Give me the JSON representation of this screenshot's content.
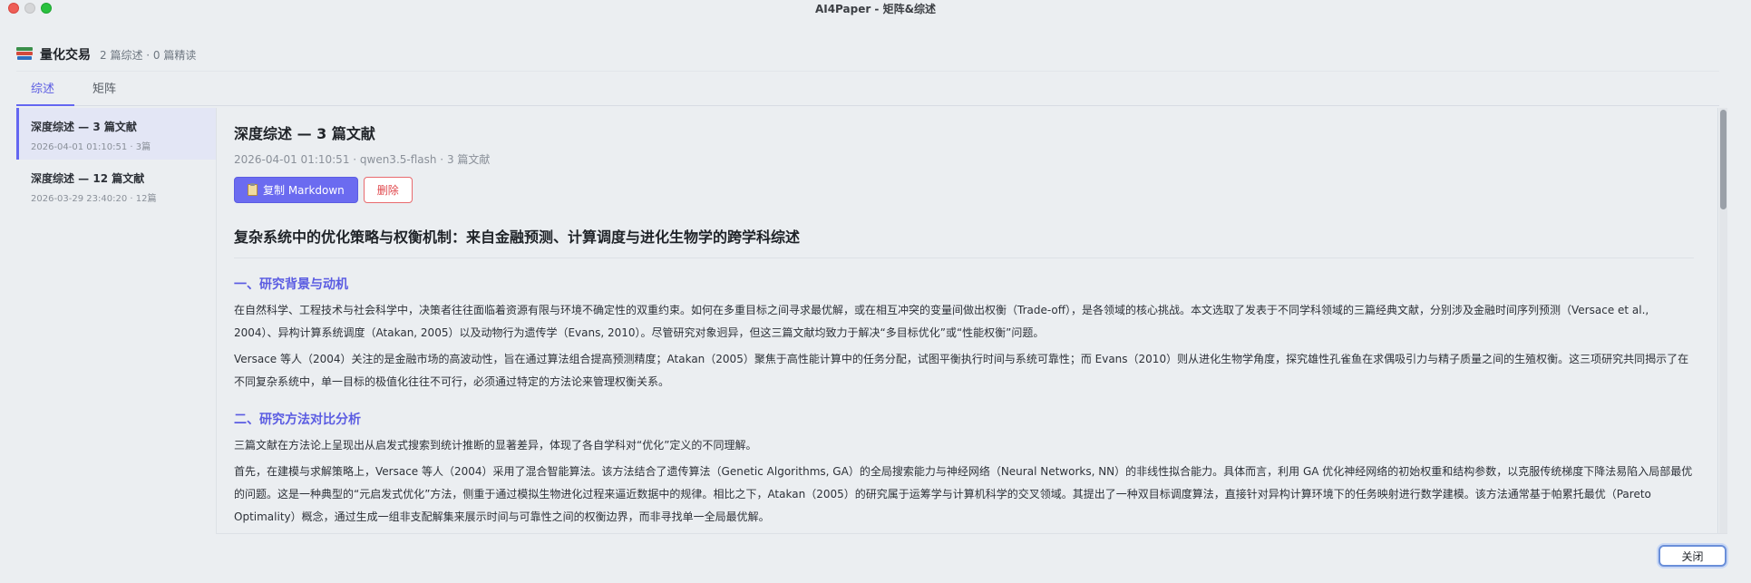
{
  "window": {
    "title": "AI4Paper - 矩阵&综述"
  },
  "header": {
    "icon": "books-icon",
    "title": "量化交易",
    "meta": "2 篇综述 · 0 篇精读"
  },
  "tabs": [
    {
      "label": "综述",
      "active": true
    },
    {
      "label": "矩阵",
      "active": false
    }
  ],
  "sidebar": {
    "items": [
      {
        "title": "深度综述 — 3 篇文献",
        "meta": "2026-04-01 01:10:51 · 3篇",
        "active": true
      },
      {
        "title": "深度综述 — 12 篇文献",
        "meta": "2026-03-29 23:40:20 · 12篇",
        "active": false
      }
    ]
  },
  "main": {
    "title": "深度综述 — 3 篇文献",
    "meta": "2026-04-01 01:10:51 · qwen3.5-flash · 3 篇文献",
    "copy_button": {
      "icon": "clipboard-icon",
      "label": "复制 Markdown"
    },
    "delete_button": "删除",
    "article_title": "复杂系统中的优化策略与权衡机制：来自金融预测、计算调度与进化生物学的跨学科综述",
    "sections": [
      {
        "heading": "一、研究背景与动机",
        "paragraphs": [
          "在自然科学、工程技术与社会科学中，决策者往往面临着资源有限与环境不确定性的双重约束。如何在多重目标之间寻求最优解，或在相互冲突的变量间做出权衡（Trade-off），是各领域的核心挑战。本文选取了发表于不同学科领域的三篇经典文献，分别涉及金融时间序列预测（Versace et al., 2004）、异构计算系统调度（Atakan, 2005）以及动物行为遗传学（Evans, 2010）。尽管研究对象迥异，但这三篇文献均致力于解决“多目标优化”或“性能权衡”问题。",
          "Versace 等人（2004）关注的是金融市场的高波动性，旨在通过算法组合提高预测精度；Atakan（2005）聚焦于高性能计算中的任务分配，试图平衡执行时间与系统可靠性；而 Evans（2010）则从进化生物学角度，探究雄性孔雀鱼在求偶吸引力与精子质量之间的生殖权衡。这三项研究共同揭示了在不同复杂系统中，单一目标的极值化往往不可行，必须通过特定的方法论来管理权衡关系。"
        ]
      },
      {
        "heading": "二、研究方法对比分析",
        "paragraphs": [
          "三篇文献在方法论上呈现出从启发式搜索到统计推断的显著差异，体现了各自学科对“优化”定义的不同理解。",
          "首先，在建模与求解策略上，Versace 等人（2004）采用了混合智能算法。该方法结合了遗传算法（Genetic Algorithms, GA）的全局搜索能力与神经网络（Neural Networks, NN）的非线性拟合能力。具体而言，利用 GA 优化神经网络的初始权重和结构参数，以克服传统梯度下降法易陷入局部最优的问题。这是一种典型的“元启发式优化”方法，侧重于通过模拟生物进化过程来逼近数据中的规律。相比之下，Atakan（2005）的研究属于运筹学与计算机科学的交叉领域。其提出了一种双目标调度算法，直接针对异构计算环境下的任务映射进行数学建模。该方法通常基于帕累托最优（Pareto Optimality）概念，通过生成一组非支配解集来展示时间与可靠性之间的权衡边界，而非寻找单一全局最优解。"
        ]
      }
    ]
  },
  "scrollbar": {
    "position_fraction": 0.0
  },
  "close_button": "关闭",
  "colors": {
    "accent": "#6366f1",
    "danger": "#e0464b",
    "background": "#ebeef1"
  }
}
